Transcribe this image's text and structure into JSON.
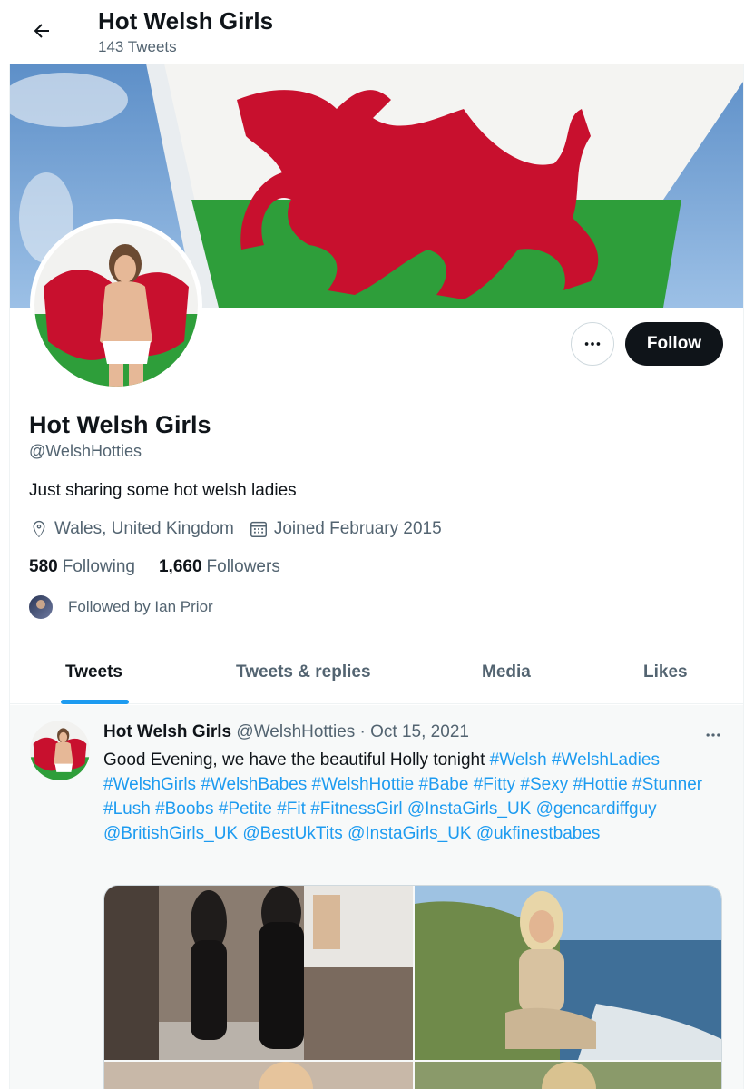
{
  "header": {
    "title": "Hot Welsh Girls",
    "tweet_count": "143 Tweets"
  },
  "profile": {
    "display_name": "Hot Welsh Girls",
    "handle": "@WelshHotties",
    "bio": "Just sharing some hot welsh ladies",
    "location": "Wales, United Kingdom",
    "joined": "Joined February 2015",
    "following_count": "580",
    "following_label": "Following",
    "followers_count": "1,660",
    "followers_label": "Followers",
    "followed_by": "Followed by Ian Prior",
    "follow_label": "Follow"
  },
  "tabs": [
    {
      "label": "Tweets",
      "active": true
    },
    {
      "label": "Tweets & replies",
      "active": false
    },
    {
      "label": "Media",
      "active": false
    },
    {
      "label": "Likes",
      "active": false
    }
  ],
  "tweet": {
    "name": "Hot Welsh Girls",
    "meta": "@WelshHotties · Oct 15, 2021",
    "text_plain": "Good Evening, we have the beautiful Holly tonight ",
    "tags": [
      "#Welsh",
      "#WelshLadies",
      "#WelshGirls",
      "#WelshBabes",
      "#WelshHottie",
      "#Babe",
      "#Fitty",
      "#Sexy",
      "#Hottie",
      "#Stunner",
      "#Lush",
      "#Boobs",
      "#Petite",
      "#Fit",
      "#FitnessGirl",
      "@InstaGirls_UK",
      "@gencardiffguy",
      "@BritishGirls_UK",
      "@BestUkTits",
      "@InstaGirls_UK",
      "@ukfinestbabes"
    ]
  },
  "colors": {
    "accent": "#1d9bf0",
    "text_primary": "#0f1419",
    "text_secondary": "#536471",
    "flag_red": "#c8102e",
    "flag_green": "#00a651"
  },
  "icons": [
    "back-arrow-icon",
    "more-dots-icon",
    "location-pin-icon",
    "calendar-icon"
  ]
}
